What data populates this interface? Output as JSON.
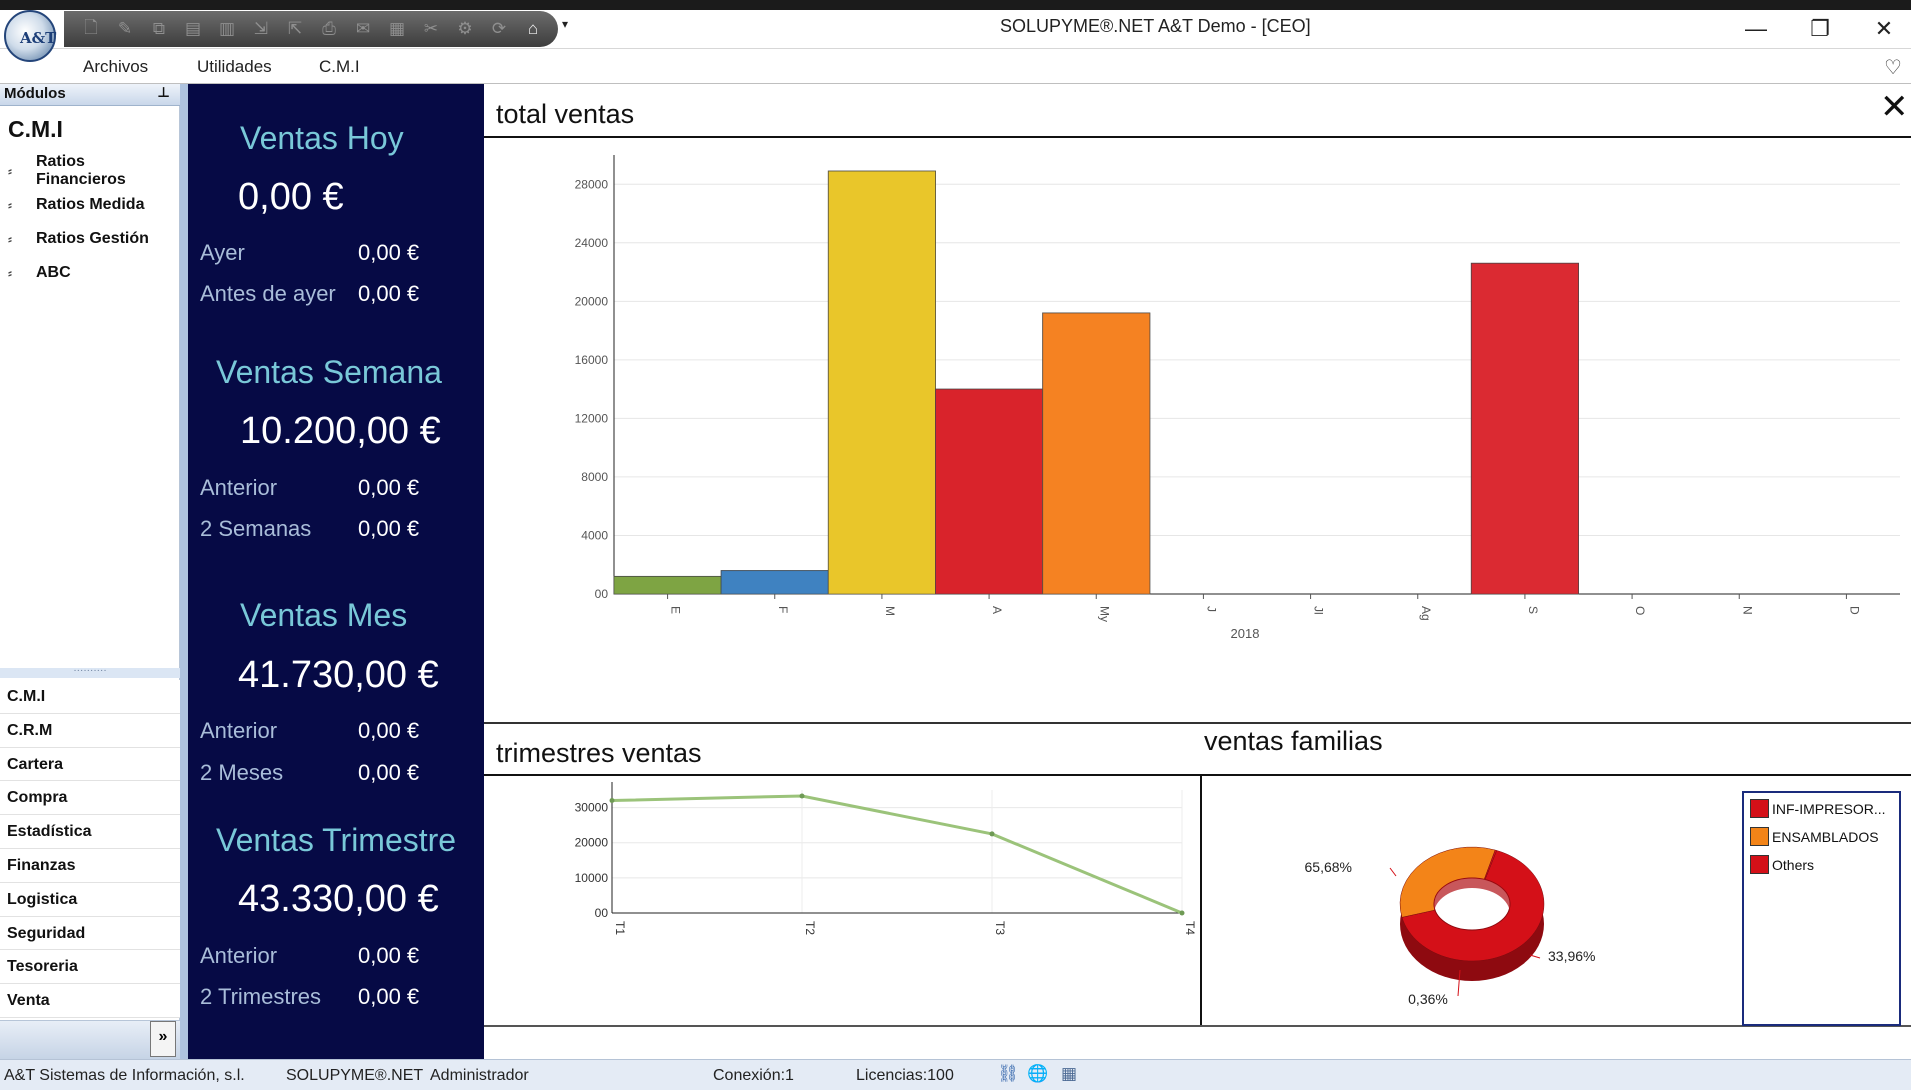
{
  "window": {
    "title": "SOLUPYME®.NET A&T Demo - [CEO]",
    "logo_text": "A&T"
  },
  "quick_access": {
    "icons": [
      "new-document-icon",
      "edit-document-icon",
      "copy-icon",
      "report-icon",
      "list-icon",
      "import-icon",
      "export-icon",
      "print-preview-icon",
      "mail-icon",
      "calculator-icon",
      "tools-icon",
      "settings-icon",
      "refresh-icon",
      "home-icon"
    ],
    "glyphs": [
      "🗋",
      "✎",
      "⧉",
      "▤",
      "▥",
      "⇲",
      "⇱",
      "⎙",
      "✉",
      "▦",
      "✂",
      "⚙",
      "⟳",
      "⌂"
    ],
    "dropdown": "▾"
  },
  "window_controls": {
    "minimize": "—",
    "restore": "❐",
    "close": "✕"
  },
  "menu": {
    "items": [
      "Archivos",
      "Utilidades",
      "C.M.I"
    ],
    "favorite_icon": "♡"
  },
  "modules": {
    "header": "Módulos",
    "pin_icon": "📌",
    "title": "C.M.I",
    "tree": [
      {
        "label": "Ratios Financieros",
        "icon": "⸗"
      },
      {
        "label": "Ratios Medida",
        "icon": "⸗"
      },
      {
        "label": "Ratios Gestión",
        "icon": "⸗"
      },
      {
        "label": "ABC",
        "icon": "⸗"
      }
    ],
    "splitter_grip": "··········",
    "nav": [
      "C.M.I",
      "C.R.M",
      "Cartera",
      "Compra",
      "Estadística",
      "Finanzas",
      "Logistica",
      "Seguridad",
      "Tesoreria",
      "Venta"
    ],
    "expand_icon": "»"
  },
  "kpi": {
    "hoy": {
      "title": "Ventas Hoy",
      "value": "0,00 €",
      "rows": [
        {
          "label": "Ayer",
          "value": "0,00 €"
        },
        {
          "label": "Antes de ayer",
          "value": "0,00 €"
        }
      ]
    },
    "semana": {
      "title": "Ventas Semana",
      "value": "10.200,00 €",
      "rows": [
        {
          "label": "Anterior",
          "value": "0,00 €"
        },
        {
          "label": "2 Semanas",
          "value": "0,00 €"
        }
      ]
    },
    "mes": {
      "title": "Ventas Mes",
      "value": "41.730,00 €",
      "rows": [
        {
          "label": "Anterior",
          "value": "0,00 €"
        },
        {
          "label": "2 Meses",
          "value": "0,00 €"
        }
      ]
    },
    "trimestre": {
      "title": "Ventas Trimestre",
      "value": "43.330,00 €",
      "rows": [
        {
          "label": "Anterior",
          "value": "0,00 €"
        },
        {
          "label": "2 Trimestres",
          "value": "0,00 €"
        }
      ]
    }
  },
  "panels": {
    "total_ventas": "total ventas",
    "trimestres": "trimestres ventas",
    "familias": "ventas familias",
    "close_icon": "✕"
  },
  "chart_data": [
    {
      "type": "bar",
      "title": "total ventas",
      "categories": [
        "E",
        "F",
        "M",
        "A",
        "My",
        "J",
        "Jl",
        "Ag",
        "S",
        "O",
        "N",
        "D"
      ],
      "values": [
        1200,
        1600,
        28900,
        14000,
        19200,
        0,
        0,
        0,
        22600,
        0,
        0,
        0
      ],
      "colors": [
        "#7ea443",
        "#3f82c1",
        "#e9c62a",
        "#d9232b",
        "#f58222",
        null,
        null,
        null,
        "#db2a32",
        null,
        null,
        null
      ],
      "xlabel": "2018",
      "ylabel": "",
      "ylim": [
        0,
        30000
      ],
      "yticks": [
        "00",
        "4000",
        "8000",
        "12000",
        "16000",
        "20000",
        "24000",
        "28000"
      ],
      "grid": true
    },
    {
      "type": "line",
      "title": "trimestres ventas",
      "categories": [
        "T1",
        "T2",
        "T3",
        "T4"
      ],
      "values": [
        32000,
        33300,
        22500,
        0
      ],
      "color": "#9bc37a",
      "ylim": [
        0,
        35000
      ],
      "yticks": [
        "00",
        "10000",
        "20000",
        "30000"
      ],
      "grid": true
    },
    {
      "type": "pie",
      "title": "ventas familias",
      "labels": [
        "INF-IMPRESOR...",
        "ENSAMBLADOS",
        "Others"
      ],
      "values": [
        65.68,
        33.96,
        0.36
      ],
      "value_labels": [
        "65,68%",
        "33,96%",
        "0,36%"
      ],
      "colors": [
        "#d41018",
        "#f38418",
        "#d41018"
      ],
      "legend": "right"
    }
  ],
  "status": {
    "company": "A&T Sistemas de Información, s.l.",
    "product": "SOLUPYME®.NET",
    "user": "Administrador",
    "connection": "Conexión:1",
    "licenses": "Licencias:100",
    "icons": [
      "network-icon",
      "globe-icon",
      "calculator-icon"
    ],
    "icon_glyphs": [
      "⛓",
      "🌐",
      "▦"
    ]
  }
}
